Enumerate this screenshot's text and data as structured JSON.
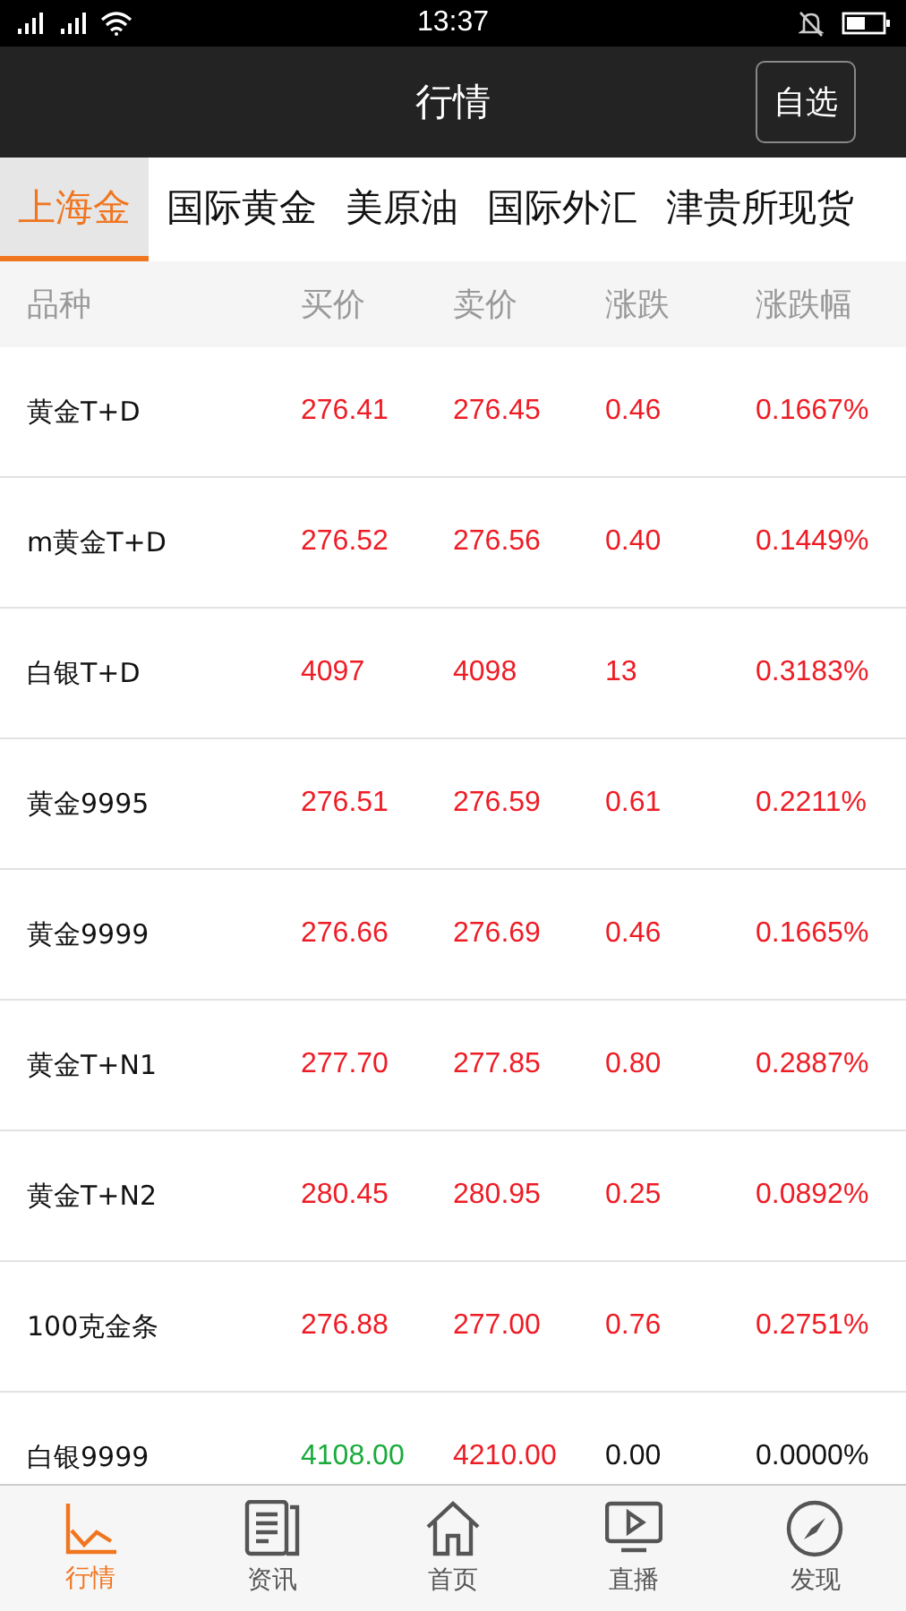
{
  "status_bar": {
    "time": "13:37"
  },
  "header": {
    "title": "行情",
    "button": "自选"
  },
  "tabs": [
    {
      "label": "上海金",
      "selected": true
    },
    {
      "label": "国际黄金",
      "selected": false
    },
    {
      "label": "美原油",
      "selected": false
    },
    {
      "label": "国际外汇",
      "selected": false
    },
    {
      "label": "津贵所现货",
      "selected": false
    }
  ],
  "table": {
    "columns": [
      "品种",
      "买价",
      "卖价",
      "涨跌",
      "涨跌幅"
    ],
    "rows": [
      {
        "name": "黄金T+D",
        "values": [
          {
            "text": "276.41",
            "color": "#ee1c25"
          },
          {
            "text": "276.45",
            "color": "#ee1c25"
          },
          {
            "text": "0.46",
            "color": "#ee1c25"
          },
          {
            "text": "0.1667%",
            "color": "#ee1c25"
          }
        ]
      },
      {
        "name": "m黄金T+D",
        "values": [
          {
            "text": "276.52",
            "color": "#ee1c25"
          },
          {
            "text": "276.56",
            "color": "#ee1c25"
          },
          {
            "text": "0.40",
            "color": "#ee1c25"
          },
          {
            "text": "0.1449%",
            "color": "#ee1c25"
          }
        ]
      },
      {
        "name": "白银T+D",
        "values": [
          {
            "text": "4097",
            "color": "#ee1c25"
          },
          {
            "text": "4098",
            "color": "#ee1c25"
          },
          {
            "text": "13",
            "color": "#ee1c25"
          },
          {
            "text": "0.3183%",
            "color": "#ee1c25"
          }
        ]
      },
      {
        "name": "黄金9995",
        "values": [
          {
            "text": "276.51",
            "color": "#ee1c25"
          },
          {
            "text": "276.59",
            "color": "#ee1c25"
          },
          {
            "text": "0.61",
            "color": "#ee1c25"
          },
          {
            "text": "0.2211%",
            "color": "#ee1c25"
          }
        ]
      },
      {
        "name": "黄金9999",
        "values": [
          {
            "text": "276.66",
            "color": "#ee1c25"
          },
          {
            "text": "276.69",
            "color": "#ee1c25"
          },
          {
            "text": "0.46",
            "color": "#ee1c25"
          },
          {
            "text": "0.1665%",
            "color": "#ee1c25"
          }
        ]
      },
      {
        "name": "黄金T+N1",
        "values": [
          {
            "text": "277.70",
            "color": "#ee1c25"
          },
          {
            "text": "277.85",
            "color": "#ee1c25"
          },
          {
            "text": "0.80",
            "color": "#ee1c25"
          },
          {
            "text": "0.2887%",
            "color": "#ee1c25"
          }
        ]
      },
      {
        "name": "黄金T+N2",
        "values": [
          {
            "text": "280.45",
            "color": "#ee1c25"
          },
          {
            "text": "280.95",
            "color": "#ee1c25"
          },
          {
            "text": "0.25",
            "color": "#ee1c25"
          },
          {
            "text": "0.0892%",
            "color": "#ee1c25"
          }
        ]
      },
      {
        "name": "100克金条",
        "values": [
          {
            "text": "276.88",
            "color": "#ee1c25"
          },
          {
            "text": "277.00",
            "color": "#ee1c25"
          },
          {
            "text": "0.76",
            "color": "#ee1c25"
          },
          {
            "text": "0.2751%",
            "color": "#ee1c25"
          }
        ]
      },
      {
        "name": "白银9999",
        "values": [
          {
            "text": "4108.00",
            "color": "#1aab3c"
          },
          {
            "text": "4210.00",
            "color": "#ee1c25"
          },
          {
            "text": "0.00",
            "color": "#111111"
          },
          {
            "text": "0.0000%",
            "color": "#111111"
          }
        ]
      }
    ]
  },
  "bottom_nav": [
    {
      "label": "行情",
      "kind": "chart",
      "selected": true
    },
    {
      "label": "资讯",
      "kind": "news",
      "selected": false
    },
    {
      "label": "首页",
      "kind": "home",
      "selected": false
    },
    {
      "label": "直播",
      "kind": "tv",
      "selected": false
    },
    {
      "label": "发现",
      "kind": "compass",
      "selected": false
    }
  ]
}
